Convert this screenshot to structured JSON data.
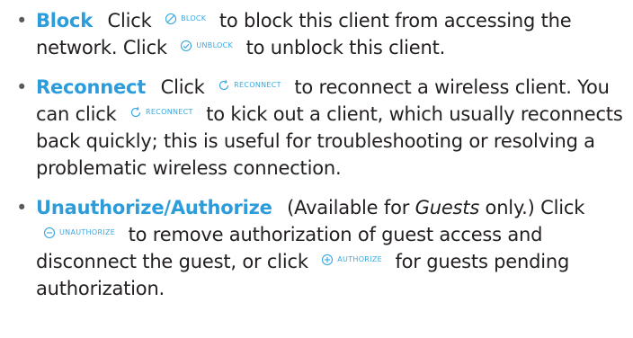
{
  "items": [
    {
      "term": "Block",
      "text_1": "Click",
      "button_1": "BLOCK",
      "text_2": "to block this client from accessing the network. Click",
      "button_2": "UNBLOCK",
      "text_3": "to unblock this client."
    },
    {
      "term": "Reconnect",
      "text_1": "Click",
      "button_1": "RECONNECT",
      "text_2": "to reconnect a wireless client. You can click",
      "button_2": "RECONNECT",
      "text_3": "to kick out a client, which usually reconnects back quickly; this is useful for troubleshooting or resolving a problematic wireless connection."
    },
    {
      "term": "Unauthorize/Authorize",
      "note_open": "(Available for",
      "note_em": "Guests",
      "note_close": "only.)",
      "text_1": "Click",
      "button_1": "UNAUTHORIZE",
      "text_2": "to remove authorization of guest access and disconnect the guest, or click",
      "button_2": "AUTHORIZE",
      "text_3": "for guests pending authorization."
    }
  ],
  "bullet_symbol": "•",
  "colors": {
    "term": "#2d9cdb",
    "button_ref": "#38a8e0",
    "body_text": "#231f20"
  },
  "icons": [
    "block-icon",
    "unblock-icon",
    "reconnect-icon",
    "unauthorize-icon",
    "authorize-icon"
  ]
}
